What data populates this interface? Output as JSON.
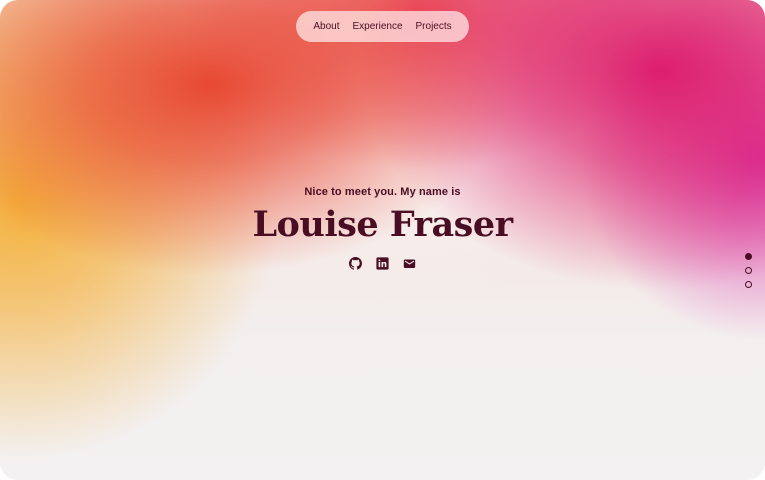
{
  "nav": {
    "items": [
      {
        "label": "About"
      },
      {
        "label": "Experience"
      },
      {
        "label": "Projects"
      }
    ]
  },
  "hero": {
    "greeting": "Nice to meet you. My name is",
    "name": "Louise Fraser",
    "socials": [
      {
        "icon": "github-icon"
      },
      {
        "icon": "linkedin-icon"
      },
      {
        "icon": "mail-icon"
      }
    ]
  },
  "section_indicator": {
    "count": 3,
    "active_index": 0
  },
  "colors": {
    "text": "#4a0e24",
    "orange": "#e7412b",
    "yellow": "#f4b038",
    "magenta": "#dc1669",
    "background": "#f3f1f1"
  }
}
